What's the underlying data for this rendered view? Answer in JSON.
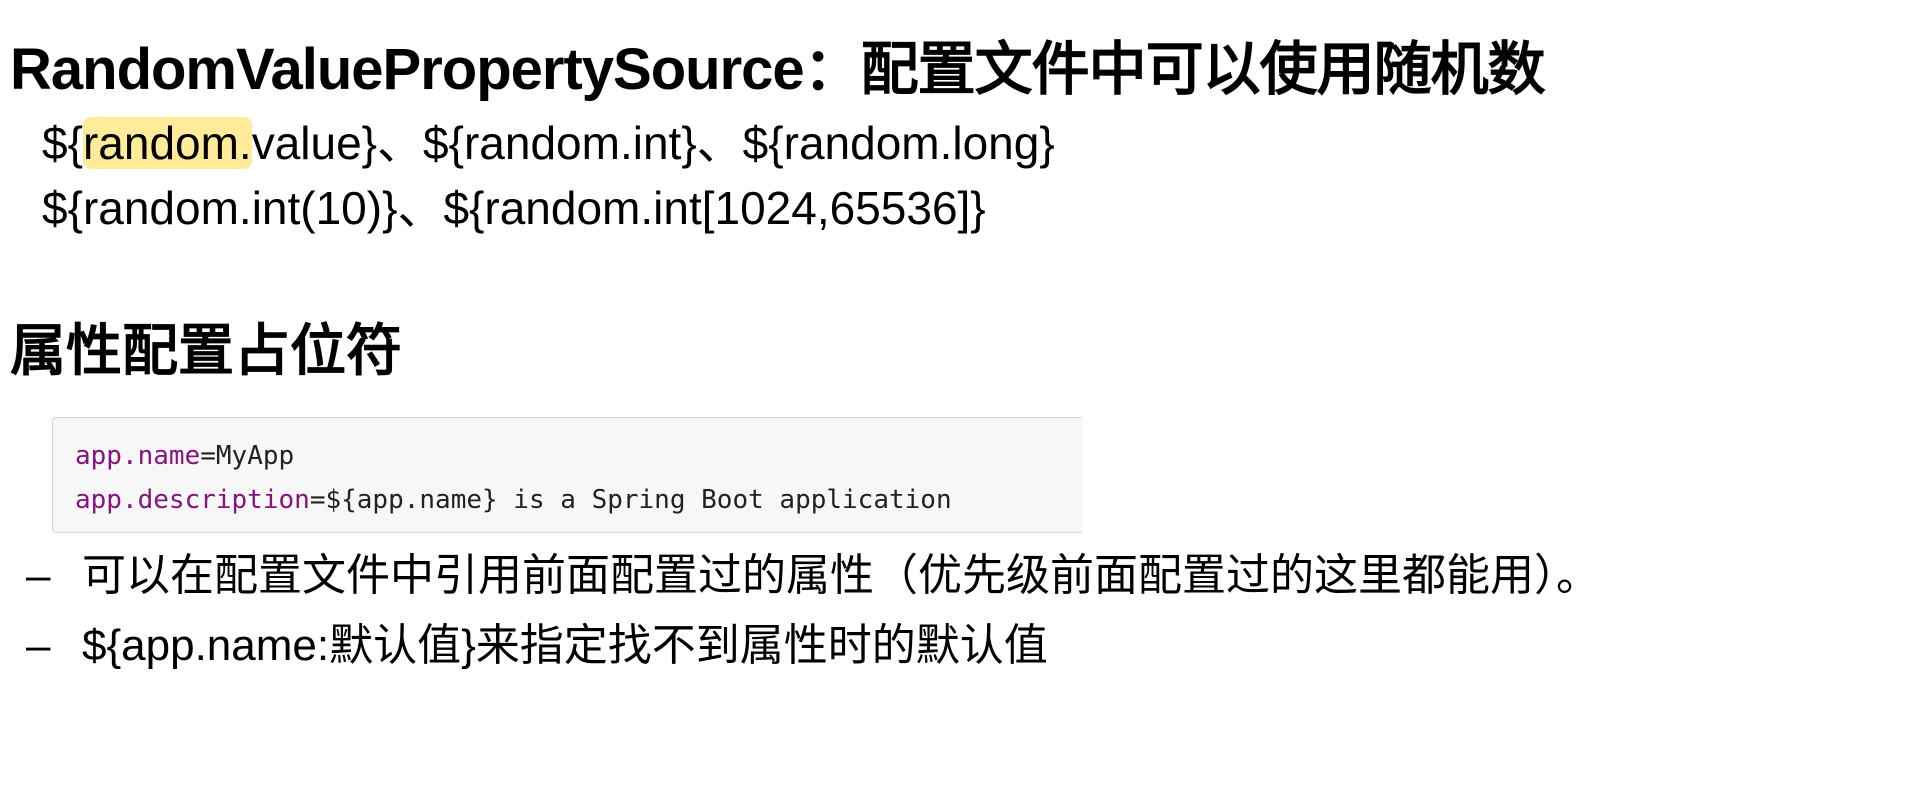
{
  "title": "RandomValuePropertySource：配置文件中可以使用随机数",
  "random_lines": {
    "line1": {
      "prefix": "${",
      "highlight": "random.",
      "rest": "value}、${random.int}、${random.long}"
    },
    "line2": "${random.int(10)}、${random.int[1024,65536]}"
  },
  "placeholder_heading": "属性配置占位符",
  "code": {
    "line1": {
      "key": "app.name",
      "value": "=MyApp"
    },
    "line2": {
      "key": "app.description",
      "value": "=${app.name} is a Spring Boot application"
    }
  },
  "bullets": [
    {
      "marker": "–",
      "text": "可以在配置文件中引用前面配置过的属性（优先级前面配置过的这里都能用）。"
    },
    {
      "marker": "–",
      "text": "${app.name:默认值}来指定找不到属性时的默认值"
    }
  ],
  "colors": {
    "highlight": "#ffeb99",
    "code_key": "#881280",
    "code_bg": "#f7f7f7"
  }
}
